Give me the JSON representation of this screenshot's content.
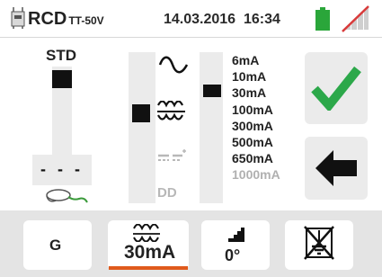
{
  "header": {
    "title": "RCD",
    "title_sub": "TT-50V",
    "datetime": "14.03.2016  16:34",
    "icons": [
      "rcd-device-icon",
      "battery-icon",
      "no-signal-icon"
    ]
  },
  "left_panel": {
    "std_label": "STD",
    "dash_label": "- - -",
    "clamp_icon": "test-lead-clamp-icon"
  },
  "waveform_panel": {
    "options": [
      "ac-sine",
      "pulsed",
      "dc-smooth",
      "DD"
    ],
    "dd_label": "DD",
    "selected": "pulsed"
  },
  "current_panel": {
    "items": [
      "6mA",
      "10mA",
      "30mA",
      "100mA",
      "300mA",
      "500mA",
      "650mA",
      "1000mA"
    ],
    "selected": "30mA",
    "disabled": [
      "1000mA"
    ]
  },
  "buttons": {
    "confirm_icon": "checkmark-icon",
    "back_icon": "arrow-left-icon"
  },
  "bottom_bar": {
    "tab_g_label": "G",
    "tab_wave_label": "30mA",
    "tab_ramp_label": "0°",
    "tab_earth_icon": "no-earth-icon",
    "active_tab": "tab-wave",
    "accent_color": "#e05a1c"
  },
  "colors": {
    "check_green": "#2ca84a",
    "battery_green": "#2aa63a",
    "signal_red": "#d83a3a"
  }
}
